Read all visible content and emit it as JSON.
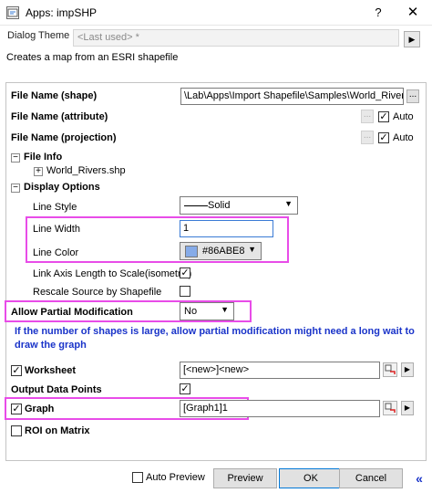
{
  "window": {
    "title": "Apps: impSHP",
    "help_label": "?",
    "close_label": "✕"
  },
  "theme": {
    "label": "Dialog Theme",
    "value": "<Last used> *",
    "arrow": "▶"
  },
  "description": "Creates a map from an ESRI shapefile",
  "file_name_shape": {
    "label": "File Name (shape)",
    "value": "\\Lab\\Apps\\Import Shapefile\\Samples\\World_Rivers.s",
    "browse": "..."
  },
  "file_name_attribute": {
    "label": "File Name (attribute)",
    "browse": "...",
    "auto_label": "Auto",
    "auto_checked": true
  },
  "file_name_projection": {
    "label": "File Name (projection)",
    "browse": "...",
    "auto_label": "Auto",
    "auto_checked": true
  },
  "file_info": {
    "label": "File Info",
    "toggle": "−",
    "item_toggle": "+",
    "item": "World_Rivers.shp"
  },
  "display_options": {
    "label": "Display Options",
    "toggle": "−",
    "line_style_label": "Line Style",
    "line_style_value": "Solid",
    "line_width_label": "Line Width",
    "line_width_value": "1",
    "line_color_label": "Line Color",
    "line_color_value": "#86ABE8",
    "line_color_hex": "#86ABE8",
    "link_axis_label": "Link Axis Length to Scale(isometric)",
    "link_axis_checked": true,
    "rescale_label": "Rescale Source by Shapefile",
    "rescale_checked": false
  },
  "partial_mod": {
    "label": "Allow Partial Modification",
    "value": "No",
    "note": "If the number of shapes is large, allow partial modification might need a long wait to draw the graph"
  },
  "worksheet": {
    "label": "Worksheet",
    "checked": true,
    "value": "[<new>]<new>"
  },
  "output_data_points": {
    "label": "Output Data Points",
    "checked": true
  },
  "graph": {
    "label": "Graph",
    "checked": true,
    "value": "[Graph1]1"
  },
  "roi_on_matrix": {
    "label": "ROI on Matrix",
    "checked": false
  },
  "bottom": {
    "auto_preview_label": "Auto Preview",
    "auto_preview_checked": false,
    "preview": "Preview",
    "ok": "OK",
    "cancel": "Cancel",
    "collapse": "«"
  },
  "glyphs": {
    "check": "✓",
    "dropdown": "▼",
    "small_arrow": "▶"
  },
  "colors": {
    "highlight": "#e84ce8",
    "note_blue": "#1a34c9",
    "line_color": "#86ABE8"
  }
}
